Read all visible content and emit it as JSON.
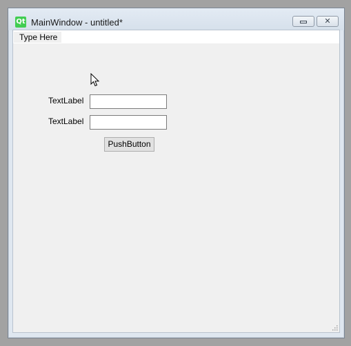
{
  "window": {
    "title": "MainWindow - untitled*",
    "app_icon_text": "Qt"
  },
  "menubar": {
    "items": [
      {
        "label": "Type Here"
      }
    ]
  },
  "form": {
    "row1": {
      "label": "TextLabel",
      "value": ""
    },
    "row2": {
      "label": "TextLabel",
      "value": ""
    },
    "button_label": "PushButton"
  },
  "icons": {
    "app": "qt-logo-icon",
    "minimize": "minimize-icon",
    "close": "close-icon",
    "cursor": "mouse-pointer-icon",
    "size_grip": "size-grip-icon"
  },
  "colors": {
    "qt_green": "#41cd52",
    "client_bg": "#f0f0f0",
    "title_bg": "#dfe7f0"
  }
}
